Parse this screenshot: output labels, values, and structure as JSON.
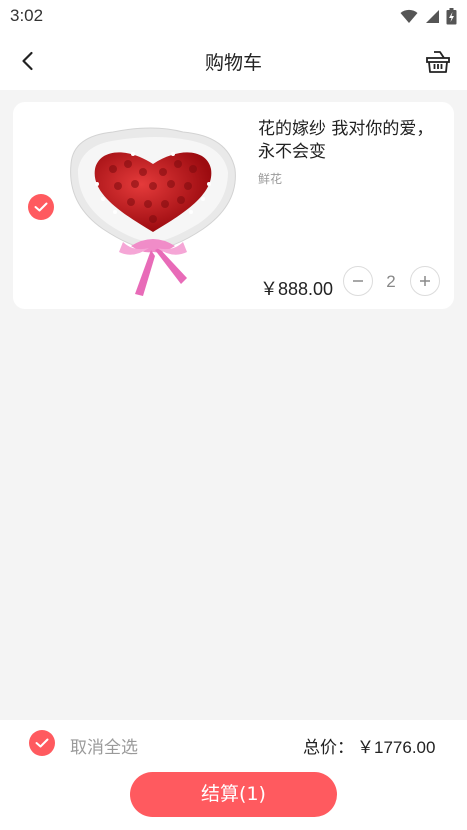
{
  "status_bar": {
    "time": "3:02",
    "icons": [
      "wifi-icon",
      "signal-icon",
      "battery-icon"
    ]
  },
  "nav": {
    "title": "购物车",
    "back_icon": "chevron-left-icon",
    "right_icon": "basket-icon"
  },
  "cart": {
    "items": [
      {
        "selected": true,
        "name": "花的嫁纱 我对你的爱，永不会变",
        "category": "鲜花",
        "price": "￥888.00",
        "quantity": "2",
        "image": "red-rose-bouquet"
      }
    ]
  },
  "footer": {
    "select_all_label": "取消全选",
    "total_label": "总价：",
    "total_value": "￥1776.00",
    "checkout_label": "结算(1)"
  },
  "colors": {
    "accent": "#ff5a5f",
    "background": "#f4f4f4",
    "card": "#ffffff"
  }
}
